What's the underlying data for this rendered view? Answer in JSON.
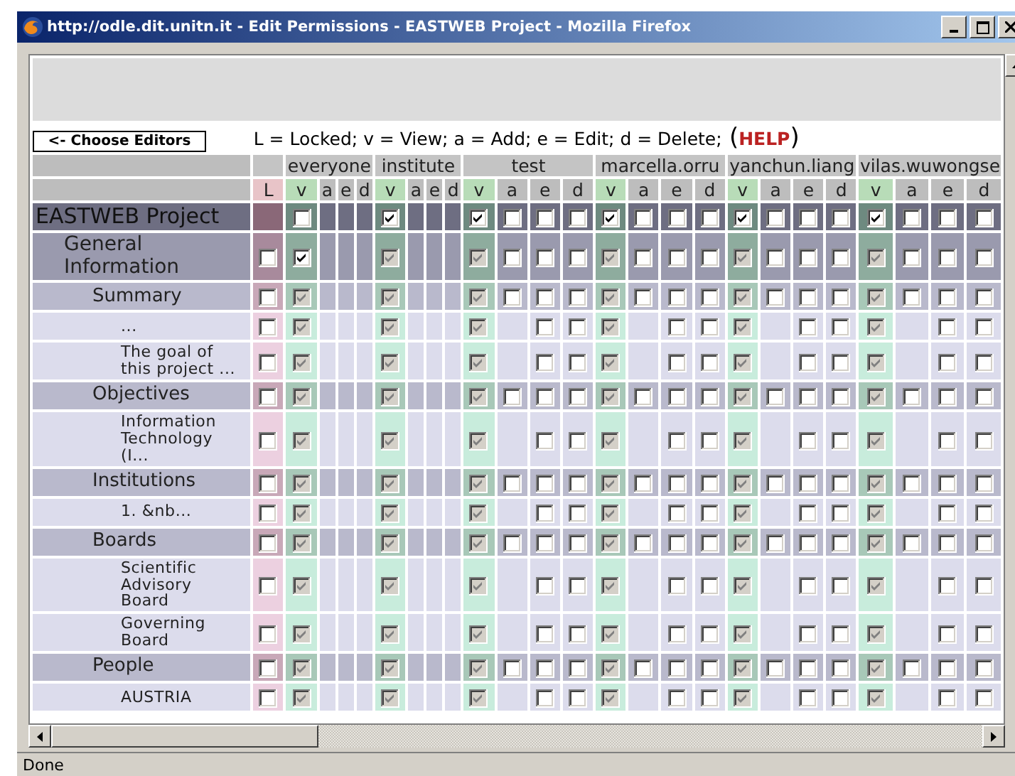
{
  "window": {
    "title": "http://odle.dit.unitn.it - Edit Permissions - EASTWEB Project - Mozilla Firefox"
  },
  "choose_editors_button": "<- Choose Editors",
  "legend": {
    "text": "L = Locked; v = View; a = Add; e = Edit; d = Delete;",
    "help_open": "(",
    "help_link": "HELP",
    "help_close": ")"
  },
  "locked_header": "L",
  "users": [
    {
      "name": "everyone",
      "columns": [
        "v",
        "a",
        "e",
        "d"
      ]
    },
    {
      "name": "institute",
      "columns": [
        "v",
        "a",
        "e",
        "d"
      ]
    },
    {
      "name": "test",
      "columns": [
        "v",
        "a",
        "e",
        "d"
      ]
    },
    {
      "name": "marcella.orru",
      "columns": [
        "v",
        "a",
        "e",
        "d"
      ]
    },
    {
      "name": "yanchun.liang",
      "columns": [
        "v",
        "a",
        "e",
        "d"
      ]
    },
    {
      "name": "vilas.wuwongse",
      "columns": [
        "v",
        "a",
        "e",
        "d"
      ]
    }
  ],
  "rows": [
    {
      "label": "EASTWEB Project",
      "perms": [
        {
          "view": {
            "checked": false,
            "disabled": false
          }
        },
        {
          "view": {
            "checked": true,
            "disabled": false
          }
        },
        {
          "view": {
            "checked": true,
            "disabled": false
          },
          "add": {
            "checked": false,
            "disabled": false
          },
          "edit": {
            "checked": false,
            "disabled": false
          },
          "delete": {
            "checked": false,
            "disabled": false
          }
        },
        {
          "view": {
            "checked": true,
            "disabled": false
          },
          "add": {
            "checked": false,
            "disabled": false
          },
          "edit": {
            "checked": false,
            "disabled": false
          },
          "delete": {
            "checked": false,
            "disabled": false
          }
        },
        {
          "view": {
            "checked": true,
            "disabled": false
          },
          "add": {
            "checked": false,
            "disabled": false
          },
          "edit": {
            "checked": false,
            "disabled": false
          },
          "delete": {
            "checked": false,
            "disabled": false
          }
        },
        {
          "view": {
            "checked": true,
            "disabled": false
          },
          "add": {
            "checked": false,
            "disabled": false
          },
          "edit": {
            "checked": false,
            "disabled": false
          },
          "delete": {
            "checked": false,
            "disabled": false
          }
        }
      ],
      "children": [
        {
          "label": "General Information",
          "locked": {
            "checked": false,
            "disabled": false
          },
          "perms": [
            {
              "view": {
                "checked": true,
                "disabled": false
              }
            },
            {
              "view": {
                "checked": true,
                "disabled": true
              }
            },
            {
              "view": {
                "checked": true,
                "disabled": true
              },
              "add": {
                "checked": false,
                "disabled": false
              },
              "edit": {
                "checked": false,
                "disabled": false
              },
              "delete": {
                "checked": false,
                "disabled": false
              }
            },
            {
              "view": {
                "checked": true,
                "disabled": true
              },
              "add": {
                "checked": false,
                "disabled": false
              },
              "edit": {
                "checked": false,
                "disabled": false
              },
              "delete": {
                "checked": false,
                "disabled": false
              }
            },
            {
              "view": {
                "checked": true,
                "disabled": true
              },
              "add": {
                "checked": false,
                "disabled": false
              },
              "edit": {
                "checked": false,
                "disabled": false
              },
              "delete": {
                "checked": false,
                "disabled": false
              }
            },
            {
              "view": {
                "checked": true,
                "disabled": true
              },
              "add": {
                "checked": false,
                "disabled": false
              },
              "edit": {
                "checked": false,
                "disabled": false
              },
              "delete": {
                "checked": false,
                "disabled": false
              }
            }
          ],
          "children": [
            {
              "label": "Summary",
              "locked": {
                "checked": false,
                "disabled": false
              },
              "perms": [
                {
                  "view": {
                    "checked": true,
                    "disabled": true
                  }
                },
                {
                  "view": {
                    "checked": true,
                    "disabled": true
                  }
                },
                {
                  "view": {
                    "checked": true,
                    "disabled": true
                  },
                  "add": {
                    "checked": false,
                    "disabled": false
                  },
                  "edit": {
                    "checked": false,
                    "disabled": false
                  },
                  "delete": {
                    "checked": false,
                    "disabled": false
                  }
                },
                {
                  "view": {
                    "checked": true,
                    "disabled": true
                  },
                  "add": {
                    "checked": false,
                    "disabled": false
                  },
                  "edit": {
                    "checked": false,
                    "disabled": false
                  },
                  "delete": {
                    "checked": false,
                    "disabled": false
                  }
                },
                {
                  "view": {
                    "checked": true,
                    "disabled": true
                  },
                  "add": {
                    "checked": false,
                    "disabled": false
                  },
                  "edit": {
                    "checked": false,
                    "disabled": false
                  },
                  "delete": {
                    "checked": false,
                    "disabled": false
                  }
                },
                {
                  "view": {
                    "checked": true,
                    "disabled": true
                  },
                  "add": {
                    "checked": false,
                    "disabled": false
                  },
                  "edit": {
                    "checked": false,
                    "disabled": false
                  },
                  "delete": {
                    "checked": false,
                    "disabled": false
                  }
                }
              ],
              "children": [
                {
                  "label": "...",
                  "locked": {
                    "checked": false,
                    "disabled": false
                  },
                  "perms": [
                    {
                      "view": {
                        "checked": true,
                        "disabled": true
                      }
                    },
                    {
                      "view": {
                        "checked": true,
                        "disabled": true
                      }
                    },
                    {
                      "view": {
                        "checked": true,
                        "disabled": true
                      },
                      "edit": {
                        "checked": false,
                        "disabled": false
                      },
                      "delete": {
                        "checked": false,
                        "disabled": false
                      }
                    },
                    {
                      "view": {
                        "checked": true,
                        "disabled": true
                      },
                      "edit": {
                        "checked": false,
                        "disabled": false
                      },
                      "delete": {
                        "checked": false,
                        "disabled": false
                      }
                    },
                    {
                      "view": {
                        "checked": true,
                        "disabled": true
                      },
                      "edit": {
                        "checked": false,
                        "disabled": false
                      },
                      "delete": {
                        "checked": false,
                        "disabled": false
                      }
                    },
                    {
                      "view": {
                        "checked": true,
                        "disabled": true
                      },
                      "edit": {
                        "checked": false,
                        "disabled": false
                      },
                      "delete": {
                        "checked": false,
                        "disabled": false
                      }
                    }
                  ]
                },
                {
                  "label": "The goal of this project ...",
                  "locked": {
                    "checked": false,
                    "disabled": false
                  },
                  "perms": [
                    {
                      "view": {
                        "checked": true,
                        "disabled": true
                      }
                    },
                    {
                      "view": {
                        "checked": true,
                        "disabled": true
                      }
                    },
                    {
                      "view": {
                        "checked": true,
                        "disabled": true
                      },
                      "edit": {
                        "checked": false,
                        "disabled": false
                      },
                      "delete": {
                        "checked": false,
                        "disabled": false
                      }
                    },
                    {
                      "view": {
                        "checked": true,
                        "disabled": true
                      },
                      "edit": {
                        "checked": false,
                        "disabled": false
                      },
                      "delete": {
                        "checked": false,
                        "disabled": false
                      }
                    },
                    {
                      "view": {
                        "checked": true,
                        "disabled": true
                      },
                      "edit": {
                        "checked": false,
                        "disabled": false
                      },
                      "delete": {
                        "checked": false,
                        "disabled": false
                      }
                    },
                    {
                      "view": {
                        "checked": true,
                        "disabled": true
                      },
                      "edit": {
                        "checked": false,
                        "disabled": false
                      },
                      "delete": {
                        "checked": false,
                        "disabled": false
                      }
                    }
                  ]
                }
              ]
            },
            {
              "label": "Objectives",
              "locked": {
                "checked": false,
                "disabled": false
              },
              "perms": [
                {
                  "view": {
                    "checked": true,
                    "disabled": true
                  }
                },
                {
                  "view": {
                    "checked": true,
                    "disabled": true
                  }
                },
                {
                  "view": {
                    "checked": true,
                    "disabled": true
                  },
                  "add": {
                    "checked": false,
                    "disabled": false
                  },
                  "edit": {
                    "checked": false,
                    "disabled": false
                  },
                  "delete": {
                    "checked": false,
                    "disabled": false
                  }
                },
                {
                  "view": {
                    "checked": true,
                    "disabled": true
                  },
                  "add": {
                    "checked": false,
                    "disabled": false
                  },
                  "edit": {
                    "checked": false,
                    "disabled": false
                  },
                  "delete": {
                    "checked": false,
                    "disabled": false
                  }
                },
                {
                  "view": {
                    "checked": true,
                    "disabled": true
                  },
                  "add": {
                    "checked": false,
                    "disabled": false
                  },
                  "edit": {
                    "checked": false,
                    "disabled": false
                  },
                  "delete": {
                    "checked": false,
                    "disabled": false
                  }
                },
                {
                  "view": {
                    "checked": true,
                    "disabled": true
                  },
                  "add": {
                    "checked": false,
                    "disabled": false
                  },
                  "edit": {
                    "checked": false,
                    "disabled": false
                  },
                  "delete": {
                    "checked": false,
                    "disabled": false
                  }
                }
              ],
              "children": [
                {
                  "label": "Information Technology (I...",
                  "locked": {
                    "checked": false,
                    "disabled": false
                  },
                  "perms": [
                    {
                      "view": {
                        "checked": true,
                        "disabled": true
                      }
                    },
                    {
                      "view": {
                        "checked": true,
                        "disabled": true
                      }
                    },
                    {
                      "view": {
                        "checked": true,
                        "disabled": true
                      },
                      "edit": {
                        "checked": false,
                        "disabled": false
                      },
                      "delete": {
                        "checked": false,
                        "disabled": false
                      }
                    },
                    {
                      "view": {
                        "checked": true,
                        "disabled": true
                      },
                      "edit": {
                        "checked": false,
                        "disabled": false
                      },
                      "delete": {
                        "checked": false,
                        "disabled": false
                      }
                    },
                    {
                      "view": {
                        "checked": true,
                        "disabled": true
                      },
                      "edit": {
                        "checked": false,
                        "disabled": false
                      },
                      "delete": {
                        "checked": false,
                        "disabled": false
                      }
                    },
                    {
                      "view": {
                        "checked": true,
                        "disabled": true
                      },
                      "edit": {
                        "checked": false,
                        "disabled": false
                      },
                      "delete": {
                        "checked": false,
                        "disabled": false
                      }
                    }
                  ]
                }
              ]
            },
            {
              "label": "Institutions",
              "locked": {
                "checked": false,
                "disabled": false
              },
              "perms": [
                {
                  "view": {
                    "checked": true,
                    "disabled": true
                  }
                },
                {
                  "view": {
                    "checked": true,
                    "disabled": true
                  }
                },
                {
                  "view": {
                    "checked": true,
                    "disabled": true
                  },
                  "add": {
                    "checked": false,
                    "disabled": false
                  },
                  "edit": {
                    "checked": false,
                    "disabled": false
                  },
                  "delete": {
                    "checked": false,
                    "disabled": false
                  }
                },
                {
                  "view": {
                    "checked": true,
                    "disabled": true
                  },
                  "add": {
                    "checked": false,
                    "disabled": false
                  },
                  "edit": {
                    "checked": false,
                    "disabled": false
                  },
                  "delete": {
                    "checked": false,
                    "disabled": false
                  }
                },
                {
                  "view": {
                    "checked": true,
                    "disabled": true
                  },
                  "add": {
                    "checked": false,
                    "disabled": false
                  },
                  "edit": {
                    "checked": false,
                    "disabled": false
                  },
                  "delete": {
                    "checked": false,
                    "disabled": false
                  }
                },
                {
                  "view": {
                    "checked": true,
                    "disabled": true
                  },
                  "add": {
                    "checked": false,
                    "disabled": false
                  },
                  "edit": {
                    "checked": false,
                    "disabled": false
                  },
                  "delete": {
                    "checked": false,
                    "disabled": false
                  }
                }
              ],
              "children": [
                {
                  "label": "1. &nb...",
                  "locked": {
                    "checked": false,
                    "disabled": false
                  },
                  "perms": [
                    {
                      "view": {
                        "checked": true,
                        "disabled": true
                      }
                    },
                    {
                      "view": {
                        "checked": true,
                        "disabled": true
                      }
                    },
                    {
                      "view": {
                        "checked": true,
                        "disabled": true
                      },
                      "edit": {
                        "checked": false,
                        "disabled": false
                      },
                      "delete": {
                        "checked": false,
                        "disabled": false
                      }
                    },
                    {
                      "view": {
                        "checked": true,
                        "disabled": true
                      },
                      "edit": {
                        "checked": false,
                        "disabled": false
                      },
                      "delete": {
                        "checked": false,
                        "disabled": false
                      }
                    },
                    {
                      "view": {
                        "checked": true,
                        "disabled": true
                      },
                      "edit": {
                        "checked": false,
                        "disabled": false
                      },
                      "delete": {
                        "checked": false,
                        "disabled": false
                      }
                    },
                    {
                      "view": {
                        "checked": true,
                        "disabled": true
                      },
                      "edit": {
                        "checked": false,
                        "disabled": false
                      },
                      "delete": {
                        "checked": false,
                        "disabled": false
                      }
                    }
                  ]
                }
              ]
            },
            {
              "label": "Boards",
              "locked": {
                "checked": false,
                "disabled": false
              },
              "perms": [
                {
                  "view": {
                    "checked": true,
                    "disabled": true
                  }
                },
                {
                  "view": {
                    "checked": true,
                    "disabled": true
                  }
                },
                {
                  "view": {
                    "checked": true,
                    "disabled": true
                  },
                  "add": {
                    "checked": false,
                    "disabled": false
                  },
                  "edit": {
                    "checked": false,
                    "disabled": false
                  },
                  "delete": {
                    "checked": false,
                    "disabled": false
                  }
                },
                {
                  "view": {
                    "checked": true,
                    "disabled": true
                  },
                  "add": {
                    "checked": false,
                    "disabled": false
                  },
                  "edit": {
                    "checked": false,
                    "disabled": false
                  },
                  "delete": {
                    "checked": false,
                    "disabled": false
                  }
                },
                {
                  "view": {
                    "checked": true,
                    "disabled": true
                  },
                  "add": {
                    "checked": false,
                    "disabled": false
                  },
                  "edit": {
                    "checked": false,
                    "disabled": false
                  },
                  "delete": {
                    "checked": false,
                    "disabled": false
                  }
                },
                {
                  "view": {
                    "checked": true,
                    "disabled": true
                  },
                  "add": {
                    "checked": false,
                    "disabled": false
                  },
                  "edit": {
                    "checked": false,
                    "disabled": false
                  },
                  "delete": {
                    "checked": false,
                    "disabled": false
                  }
                }
              ],
              "children": [
                {
                  "label": "Scientific Advisory Board",
                  "locked": {
                    "checked": false,
                    "disabled": false
                  },
                  "perms": [
                    {
                      "view": {
                        "checked": true,
                        "disabled": true
                      }
                    },
                    {
                      "view": {
                        "checked": true,
                        "disabled": true
                      }
                    },
                    {
                      "view": {
                        "checked": true,
                        "disabled": true
                      },
                      "edit": {
                        "checked": false,
                        "disabled": false
                      },
                      "delete": {
                        "checked": false,
                        "disabled": false
                      }
                    },
                    {
                      "view": {
                        "checked": true,
                        "disabled": true
                      },
                      "edit": {
                        "checked": false,
                        "disabled": false
                      },
                      "delete": {
                        "checked": false,
                        "disabled": false
                      }
                    },
                    {
                      "view": {
                        "checked": true,
                        "disabled": true
                      },
                      "edit": {
                        "checked": false,
                        "disabled": false
                      },
                      "delete": {
                        "checked": false,
                        "disabled": false
                      }
                    },
                    {
                      "view": {
                        "checked": true,
                        "disabled": true
                      },
                      "edit": {
                        "checked": false,
                        "disabled": false
                      },
                      "delete": {
                        "checked": false,
                        "disabled": false
                      }
                    }
                  ]
                },
                {
                  "label": "Governing Board",
                  "locked": {
                    "checked": false,
                    "disabled": false
                  },
                  "perms": [
                    {
                      "view": {
                        "checked": true,
                        "disabled": true
                      }
                    },
                    {
                      "view": {
                        "checked": true,
                        "disabled": true
                      }
                    },
                    {
                      "view": {
                        "checked": true,
                        "disabled": true
                      },
                      "edit": {
                        "checked": false,
                        "disabled": false
                      },
                      "delete": {
                        "checked": false,
                        "disabled": false
                      }
                    },
                    {
                      "view": {
                        "checked": true,
                        "disabled": true
                      },
                      "edit": {
                        "checked": false,
                        "disabled": false
                      },
                      "delete": {
                        "checked": false,
                        "disabled": false
                      }
                    },
                    {
                      "view": {
                        "checked": true,
                        "disabled": true
                      },
                      "edit": {
                        "checked": false,
                        "disabled": false
                      },
                      "delete": {
                        "checked": false,
                        "disabled": false
                      }
                    },
                    {
                      "view": {
                        "checked": true,
                        "disabled": true
                      },
                      "edit": {
                        "checked": false,
                        "disabled": false
                      },
                      "delete": {
                        "checked": false,
                        "disabled": false
                      }
                    }
                  ]
                }
              ]
            },
            {
              "label": "People",
              "locked": {
                "checked": false,
                "disabled": false
              },
              "perms": [
                {
                  "view": {
                    "checked": true,
                    "disabled": true
                  }
                },
                {
                  "view": {
                    "checked": true,
                    "disabled": true
                  }
                },
                {
                  "view": {
                    "checked": true,
                    "disabled": true
                  },
                  "add": {
                    "checked": false,
                    "disabled": false
                  },
                  "edit": {
                    "checked": false,
                    "disabled": false
                  },
                  "delete": {
                    "checked": false,
                    "disabled": false
                  }
                },
                {
                  "view": {
                    "checked": true,
                    "disabled": true
                  },
                  "add": {
                    "checked": false,
                    "disabled": false
                  },
                  "edit": {
                    "checked": false,
                    "disabled": false
                  },
                  "delete": {
                    "checked": false,
                    "disabled": false
                  }
                },
                {
                  "view": {
                    "checked": true,
                    "disabled": true
                  },
                  "add": {
                    "checked": false,
                    "disabled": false
                  },
                  "edit": {
                    "checked": false,
                    "disabled": false
                  },
                  "delete": {
                    "checked": false,
                    "disabled": false
                  }
                },
                {
                  "view": {
                    "checked": true,
                    "disabled": true
                  },
                  "add": {
                    "checked": false,
                    "disabled": false
                  },
                  "edit": {
                    "checked": false,
                    "disabled": false
                  },
                  "delete": {
                    "checked": false,
                    "disabled": false
                  }
                }
              ],
              "children": [
                {
                  "label": "AUSTRIA",
                  "locked": {
                    "checked": false,
                    "disabled": false
                  },
                  "perms": [
                    {
                      "view": {
                        "checked": true,
                        "disabled": true
                      }
                    },
                    {
                      "view": {
                        "checked": true,
                        "disabled": true
                      }
                    },
                    {
                      "view": {
                        "checked": true,
                        "disabled": true
                      },
                      "edit": {
                        "checked": false,
                        "disabled": false
                      },
                      "delete": {
                        "checked": false,
                        "disabled": false
                      }
                    },
                    {
                      "view": {
                        "checked": true,
                        "disabled": true
                      },
                      "edit": {
                        "checked": false,
                        "disabled": false
                      },
                      "delete": {
                        "checked": false,
                        "disabled": false
                      }
                    },
                    {
                      "view": {
                        "checked": true,
                        "disabled": true
                      },
                      "edit": {
                        "checked": false,
                        "disabled": false
                      },
                      "delete": {
                        "checked": false,
                        "disabled": false
                      }
                    },
                    {
                      "view": {
                        "checked": true,
                        "disabled": true
                      },
                      "edit": {
                        "checked": false,
                        "disabled": false
                      },
                      "delete": {
                        "checked": false,
                        "disabled": false
                      }
                    }
                  ]
                }
              ]
            }
          ]
        }
      ]
    }
  ],
  "status_bar": "Done"
}
